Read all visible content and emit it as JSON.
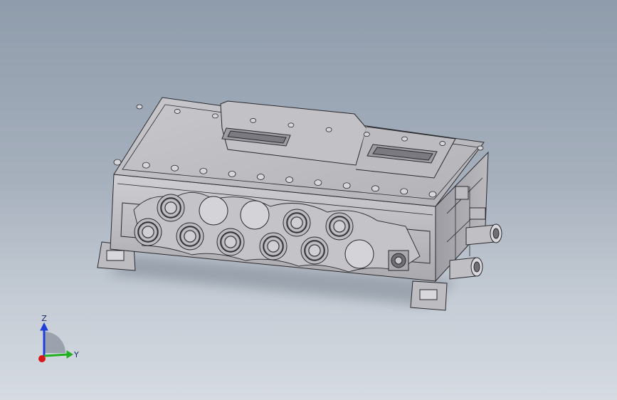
{
  "viewport": {
    "background_top": "#8f9cab",
    "background_bottom": "#d6dbe2"
  },
  "model": {
    "body_color": "#b8b8bc",
    "edge_color": "#2a2a2e"
  },
  "triad": {
    "z_label": "Z",
    "y_label": "Y",
    "z_color": "#1f3fd8",
    "y_color": "#20b020",
    "x_color": "#d81818"
  }
}
